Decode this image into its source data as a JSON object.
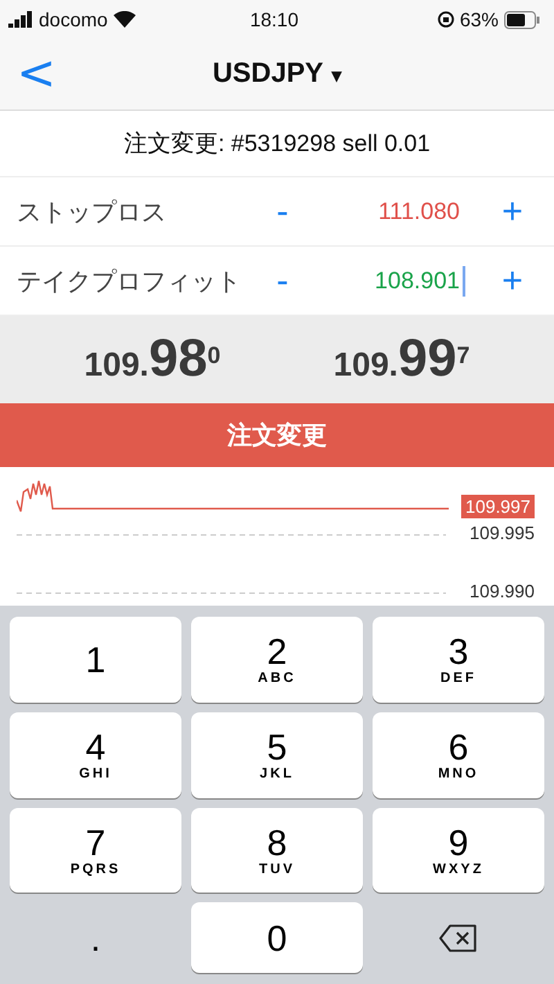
{
  "status_bar": {
    "carrier": "docomo",
    "time": "18:10",
    "battery": "63%"
  },
  "nav": {
    "back": "<",
    "title": "USDJPY",
    "dropdown": "▾"
  },
  "order_title": "注文変更: #5319298 sell 0.01",
  "fields": [
    {
      "label": "ストップロス",
      "minus": "-",
      "value": "111.080",
      "plus": "+",
      "color": "#e0504a",
      "focused": false
    },
    {
      "label": "テイクプロフィット",
      "minus": "-",
      "value": "108.901",
      "plus": "+",
      "color": "#1aa34a",
      "focused": true
    }
  ],
  "quotes": [
    {
      "prefix": "109.",
      "big": "98",
      "sup": "0"
    },
    {
      "prefix": "109.",
      "big": "99",
      "sup": "7"
    }
  ],
  "submit_button": "注文変更",
  "chart": {
    "current_price": "109.997",
    "grid_labels": [
      "109.995",
      "109.990"
    ]
  },
  "keypad": [
    {
      "kind": "digit",
      "digit": "1"
    },
    {
      "kind": "digit",
      "digit": "2",
      "letters": "ABC"
    },
    {
      "kind": "digit",
      "digit": "3",
      "letters": "DEF"
    },
    {
      "kind": "digit",
      "digit": "4",
      "letters": "GHI"
    },
    {
      "kind": "digit",
      "digit": "5",
      "letters": "JKL"
    },
    {
      "kind": "digit",
      "digit": "6",
      "letters": "MNO"
    },
    {
      "kind": "digit",
      "digit": "7",
      "letters": "PQRS"
    },
    {
      "kind": "digit",
      "digit": "8",
      "letters": "TUV"
    },
    {
      "kind": "digit",
      "digit": "9",
      "letters": "WXYZ"
    },
    {
      "kind": "plain",
      "digit": "."
    },
    {
      "kind": "digit",
      "digit": "0"
    },
    {
      "kind": "backspace"
    }
  ]
}
